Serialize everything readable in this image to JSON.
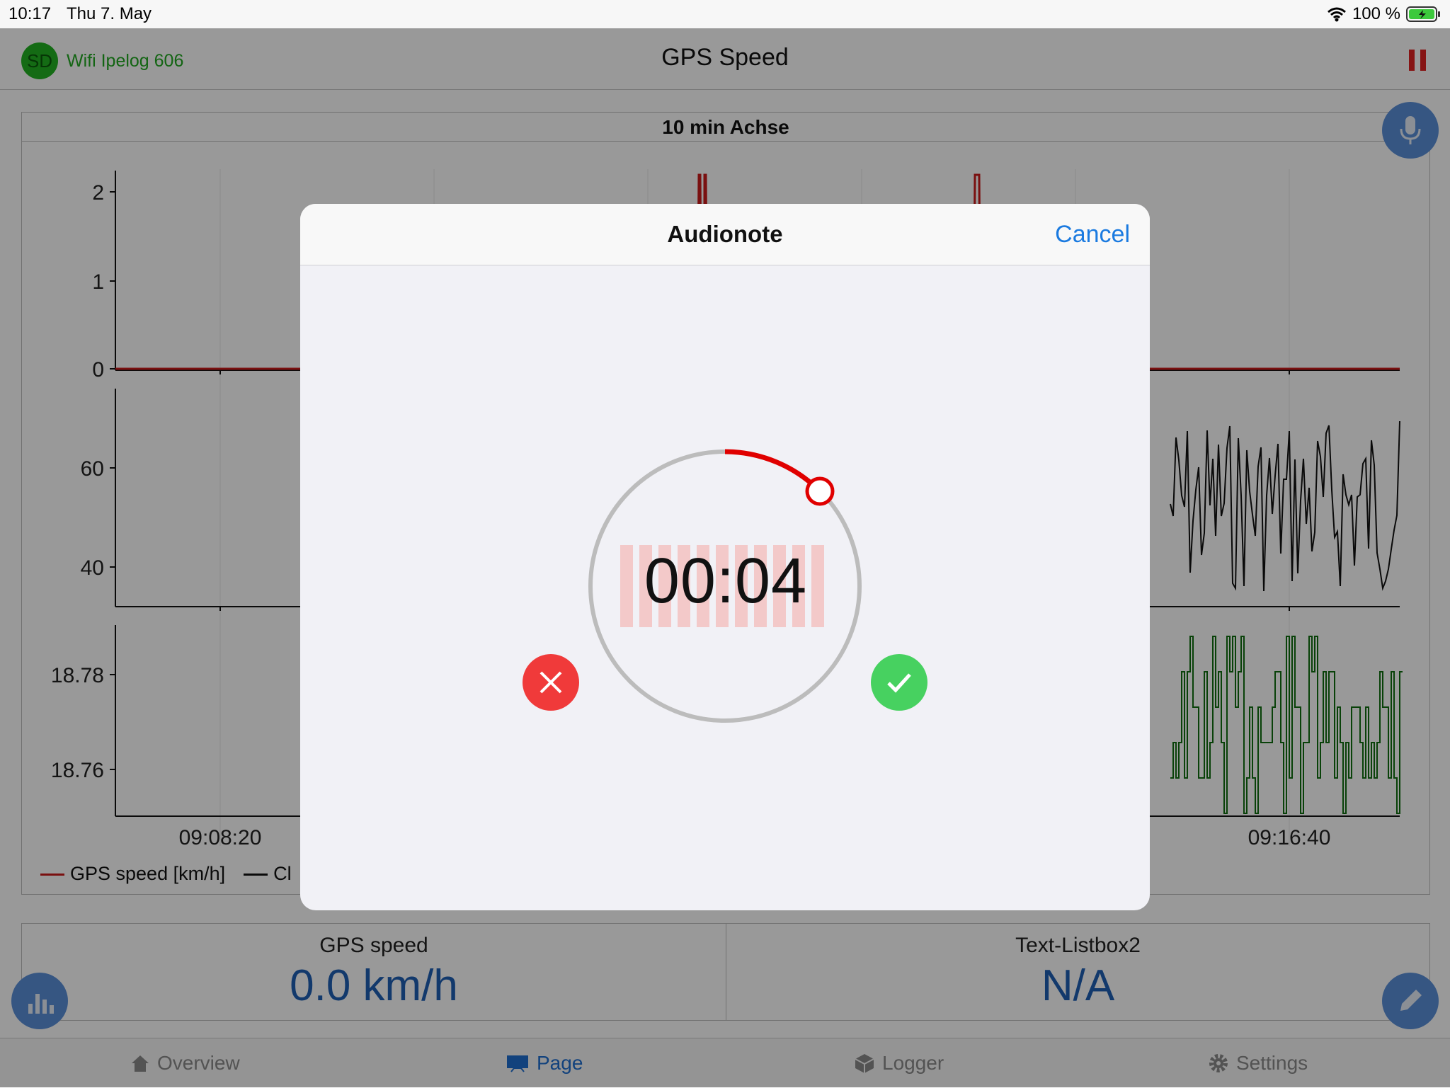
{
  "status_bar": {
    "time": "10:17",
    "date": "Thu 7. May",
    "battery": "100 %"
  },
  "header": {
    "badge": "SD",
    "device": "Wifi Ipelog 606",
    "title": "GPS Speed"
  },
  "chart_panel": {
    "title": "10 min Achse"
  },
  "chart_data": [
    {
      "type": "line",
      "series": [
        {
          "name": "GPS speed [km/h]",
          "color": "#cc1b1b"
        }
      ],
      "yticks": [
        "2",
        "1",
        "0"
      ],
      "ylim": [
        0,
        2.2
      ]
    },
    {
      "type": "line",
      "series": [
        {
          "name": "Cl",
          "color": "#111111"
        }
      ],
      "yticks": [
        "60",
        "40"
      ],
      "ylim": [
        32,
        76
      ]
    },
    {
      "type": "line",
      "series": [
        {
          "color": "#0f6f0f"
        }
      ],
      "yticks": [
        "18.78",
        "18.76"
      ],
      "ylim": [
        18.75,
        18.79
      ],
      "xticks": [
        "09:08:20",
        "09:16:40"
      ]
    }
  ],
  "legend": [
    {
      "label": "GPS speed [km/h]",
      "color": "#cc1b1b"
    },
    {
      "label": "Cl",
      "color": "#111111"
    }
  ],
  "values": [
    {
      "label": "GPS speed",
      "value": "0.0 km/h"
    },
    {
      "label": "Text-Listbox2",
      "value": "N/A"
    }
  ],
  "tabs": [
    {
      "label": "Overview",
      "icon": "house-icon"
    },
    {
      "label": "Page",
      "icon": "monitor-icon",
      "active": true
    },
    {
      "label": "Logger",
      "icon": "cube-icon"
    },
    {
      "label": "Settings",
      "icon": "gear-icon"
    }
  ],
  "dialog": {
    "title": "Audionote",
    "cancel": "Cancel",
    "timer": "00:04"
  },
  "colors": {
    "accent": "#1a7ae0",
    "record": "#e00000",
    "reject": "#f03a3a",
    "accept": "#47d160"
  }
}
